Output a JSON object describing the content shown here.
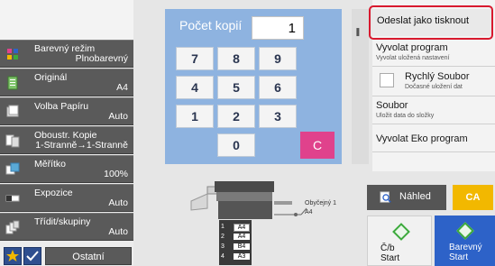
{
  "copies": {
    "label": "Počet kopií",
    "value": "1"
  },
  "keypad": {
    "keys": [
      "7",
      "8",
      "9",
      "4",
      "5",
      "6",
      "1",
      "2",
      "3",
      "0"
    ],
    "clear": "C"
  },
  "settings": {
    "color_mode": {
      "label": "Barevný režim",
      "value": "Plnobarevný"
    },
    "original": {
      "label": "Originál",
      "value": "A4"
    },
    "paper": {
      "label": "Volba Papíru",
      "value": "Auto"
    },
    "duplex": {
      "label": "Oboustr. Kopie",
      "value": "1-Stranně→1-Stranně"
    },
    "scale": {
      "label": "Měřítko",
      "value": "100%"
    },
    "exposure": {
      "label": "Expozice",
      "value": "Auto"
    },
    "sort": {
      "label": "Třídit/skupiny",
      "value": "Auto"
    }
  },
  "bottom": {
    "other": "Ostatní"
  },
  "right": {
    "send_as_print": "Odeslat jako tisknout",
    "recall_program": {
      "title": "Vyvolat program",
      "sub": "Vyvolat uložená nastavení"
    },
    "quick_file": {
      "title": "Rychlý Soubor",
      "sub": "Dočasné uložení dat"
    },
    "file": {
      "title": "Soubor",
      "sub": "Uložit data do složky"
    },
    "eco": {
      "title": "Vyvolat Eko program"
    }
  },
  "machine": {
    "output_paper": "Obyčejný 1",
    "output_size": "A4",
    "trays": [
      {
        "n": "1",
        "p": "A4"
      },
      {
        "n": "2",
        "p": "A4"
      },
      {
        "n": "3",
        "p": "B4"
      },
      {
        "n": "4",
        "p": "A3"
      }
    ]
  },
  "actions": {
    "preview": "Náhled",
    "ca": "CA",
    "bw_start_1": "Č/b",
    "bw_start_2": "Start",
    "color_start_1": "Barevný",
    "color_start_2": "Start"
  },
  "colors": {
    "keypad_bg": "#8eb3e0",
    "clear_key": "#e0428c",
    "ca_button": "#f2b800",
    "color_start": "#2d62c8",
    "highlight": "#d8192e"
  }
}
